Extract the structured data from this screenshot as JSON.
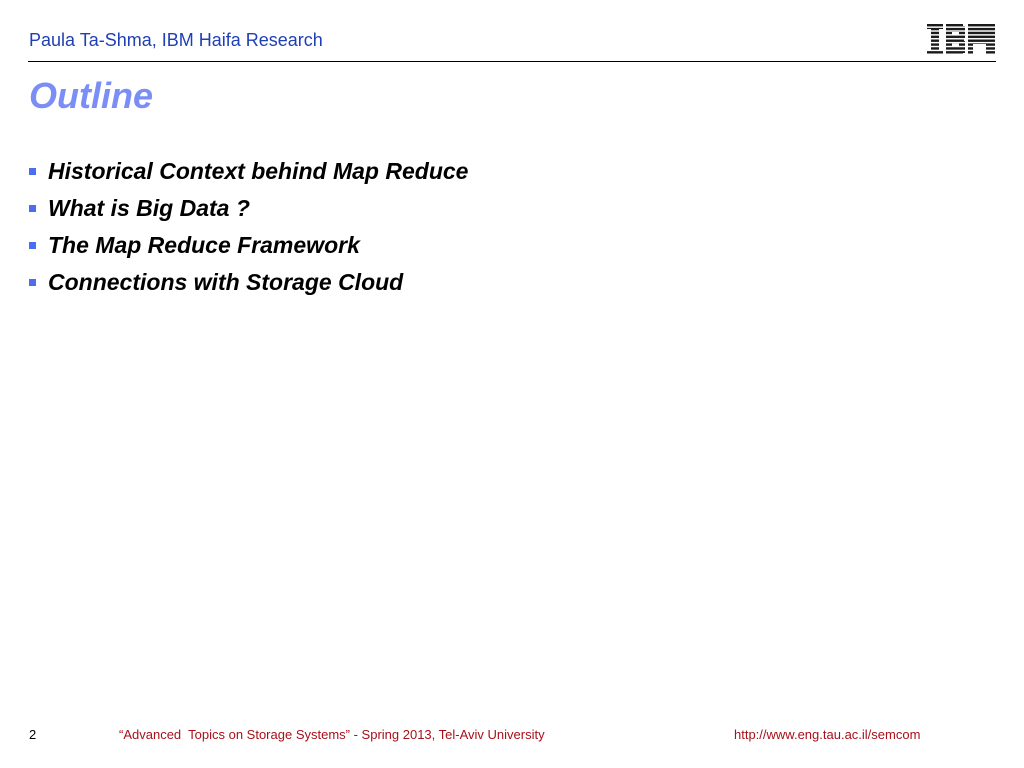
{
  "header": {
    "author": "Paula Ta-Shma, IBM Haifa Research",
    "logo_text": "IBM",
    "logo_icon": "ibm-logo"
  },
  "slide": {
    "title": "Outline",
    "bullets": [
      {
        "text": "Historical Context behind Map Reduce"
      },
      {
        "text": "What is Big Data ?"
      },
      {
        "text": "The Map Reduce Framework"
      },
      {
        "text": "Connections with Storage Cloud"
      }
    ]
  },
  "footer": {
    "page_number": "2",
    "course": "“Advanced  Topics on Storage Systems” - Spring 2013, Tel-Aviv University",
    "url": "http://www.eng.tau.ac.il/semcom"
  },
  "colors": {
    "header_text": "#1f3fb6",
    "title": "#7b8ef5",
    "bullet_marker": "#4d6df0",
    "footer_text": "#a8101a"
  }
}
